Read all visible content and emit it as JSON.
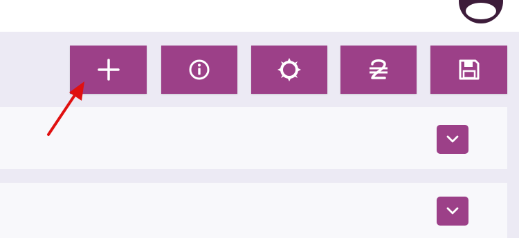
{
  "colors": {
    "accent": "#9c4088",
    "avatar": "#3d1c3a",
    "background": "#eceaf4",
    "panel": "#f8f8fb",
    "annotation_arrow": "#e01010"
  },
  "toolbar": {
    "buttons": [
      {
        "icon": "plus-icon"
      },
      {
        "icon": "info-icon"
      },
      {
        "icon": "refresh-icon"
      },
      {
        "icon": "currency-icon"
      },
      {
        "icon": "save-icon"
      }
    ]
  },
  "panels": [
    {
      "toggle_icon": "chevron-down-icon"
    },
    {
      "toggle_icon": "chevron-down-icon"
    }
  ],
  "annotation": {
    "icon": "pointer-arrow"
  }
}
